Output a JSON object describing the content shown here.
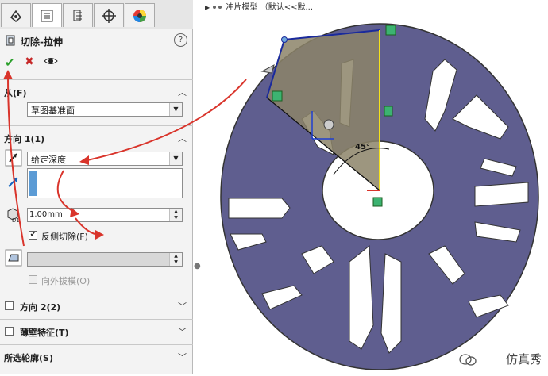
{
  "feature": {
    "title": "切除-拉伸",
    "help": "?"
  },
  "from_section": {
    "label": "从(F)",
    "combo_value": "草图基准面"
  },
  "direction1": {
    "label": "方向 1(1)",
    "end_condition": "给定深度",
    "depth_value": "1.00mm",
    "flip_side_label": "反侧切除(F)",
    "flip_side_checked": true,
    "draft_outward_label": "向外拔模(O)"
  },
  "direction2": {
    "label": "方向 2(2)"
  },
  "thin_feature": {
    "label": "薄壁特征(T)"
  },
  "selected_contours": {
    "label": "所选轮廓(S)"
  },
  "tree_breadcrumb": "冲片模型 （默认<<默...",
  "viewport": {
    "angle_label": "45°"
  },
  "watermark": {
    "text": "仿真秀"
  },
  "colors": {
    "part_face": "#5f5e8f",
    "cut_preview": "#8c8468",
    "annotation_red": "#d9342b",
    "accent_blue": "#5b9bd5"
  }
}
